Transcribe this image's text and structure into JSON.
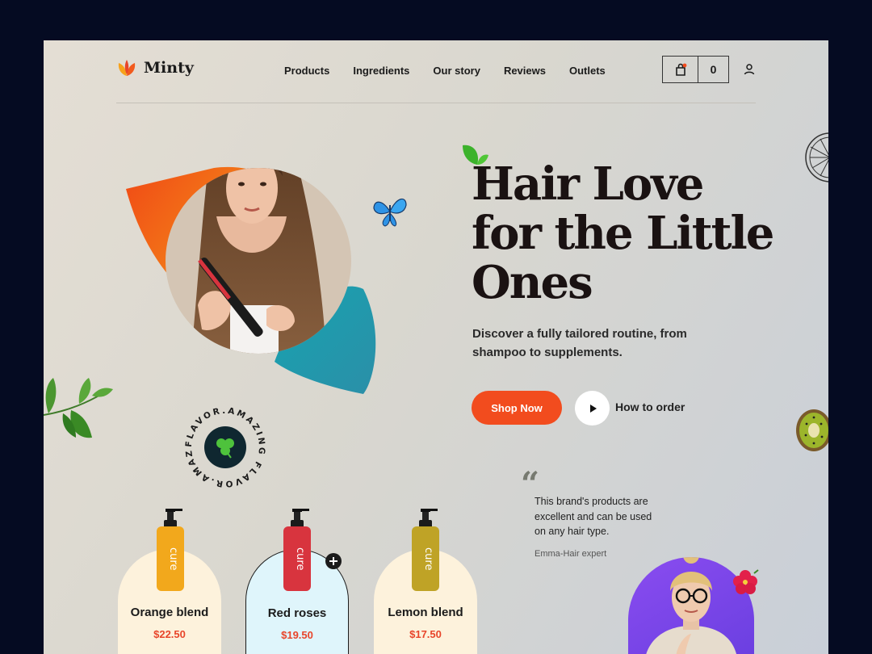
{
  "brand": {
    "name": "Minty"
  },
  "nav": {
    "items": [
      "Products",
      "Ingredients",
      "Our story",
      "Reviews",
      "Outlets"
    ]
  },
  "cart": {
    "count": "0"
  },
  "hero": {
    "title_lines": [
      "Hair Love",
      "for the Little",
      "Ones"
    ],
    "subtitle": "Discover a fully tailored routine, from shampoo to supplements.",
    "primary_button": "Shop Now",
    "secondary_link": "How to order"
  },
  "badge": {
    "text": "FLAVOR.AMAZING FLAVOR.AMAZING"
  },
  "testimonial": {
    "mark": "“",
    "quote": "This brand's products are excellent and can be used on any hair type.",
    "author": "Emma-Hair expert"
  },
  "products": [
    {
      "name": "Orange blend",
      "price": "$22.50",
      "bg": "#fdf2dc",
      "bottle": "#f2a81c"
    },
    {
      "name": "Red roses",
      "price": "$19.50",
      "bg": "#dff5fb",
      "bottle": "#d8343e"
    },
    {
      "name": "Lemon blend",
      "price": "$17.50",
      "bg": "#fdf2dc",
      "bottle": "#bfa326"
    }
  ],
  "bottle_label": "cure",
  "colors": {
    "accent": "#f24c1e",
    "price": "#e8452a",
    "dark": "#1a1212"
  },
  "icons": [
    "logo-icon",
    "cart-icon",
    "user-icon",
    "play-icon",
    "plus-icon",
    "clover-icon",
    "butterfly-icon",
    "leaf-icon",
    "lemon-slice-icon",
    "kiwi-icon",
    "hibiscus-icon"
  ]
}
